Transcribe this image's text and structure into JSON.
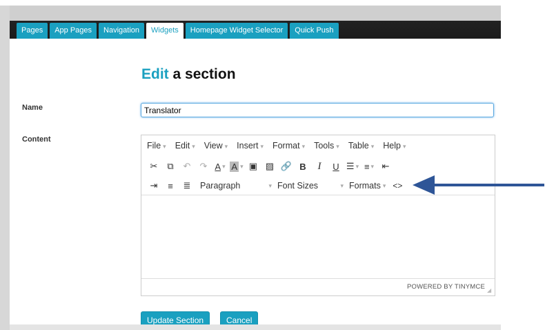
{
  "tabs": [
    "Pages",
    "App Pages",
    "Navigation",
    "Widgets",
    "Homepage Widget Selector",
    "Quick Push"
  ],
  "active_tab": "Widgets",
  "page_title": {
    "accent": "Edit",
    "rest": " a section"
  },
  "form": {
    "name_label": "Name",
    "name_value": "Translator",
    "content_label": "Content"
  },
  "editor": {
    "menu": [
      "File",
      "Edit",
      "View",
      "Insert",
      "Format",
      "Tools",
      "Table",
      "Help"
    ],
    "paragraph": "Paragraph",
    "font_sizes": "Font Sizes",
    "formats": "Formats",
    "code_icon": "<>",
    "status": "POWERED BY TINYMCE"
  },
  "buttons": {
    "update": "Update Section",
    "cancel": "Cancel"
  },
  "colors": {
    "accent": "#1aa0c0",
    "arrow": "#2e5597"
  }
}
